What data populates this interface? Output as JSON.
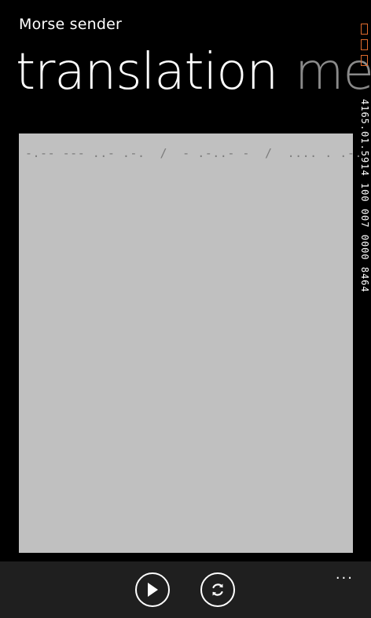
{
  "app": {
    "title": "Morse sender"
  },
  "pivot": {
    "active_label": "translation",
    "next_label_partial": "me"
  },
  "debug_counter": {
    "value": "4165.01.5914 100 007 0000 8464"
  },
  "text_area": {
    "morse_value": "-.-- --- ..- .-.  /  - .-..- -  /  .... . .-. ."
  },
  "app_bar": {
    "buttons": [
      {
        "icon": "play-icon"
      },
      {
        "icon": "refresh-icon"
      }
    ],
    "more_label": "..."
  },
  "colors": {
    "background": "#000000",
    "text_area": "#c0c0c0",
    "app_bar": "#1f1f1f",
    "accent_debug": "#e06a2c",
    "pivot_inactive": "#8a8a8a"
  }
}
